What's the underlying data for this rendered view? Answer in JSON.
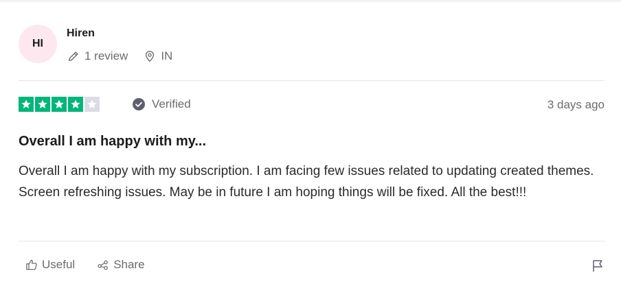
{
  "reviewer": {
    "initials": "HI",
    "name": "Hiren",
    "review_count": "1 review",
    "country": "IN",
    "avatar_color": "#fde8ef"
  },
  "rating": {
    "stars": 4,
    "max": 5,
    "filled_color": "#00b67a",
    "empty_color": "#dcdce6"
  },
  "verified_label": "Verified",
  "date": "3 days ago",
  "review": {
    "title": "Overall I am happy with my...",
    "body": "Overall I am happy with my subscription. I am facing few issues related to updating created themes. Screen refreshing issues. May be in future I am hoping things will be fixed. All the best!!!"
  },
  "actions": {
    "useful_label": "Useful",
    "share_label": "Share"
  },
  "icons": [
    "pencil-icon",
    "location-pin-icon",
    "star-icon",
    "verified-check-icon",
    "thumbs-up-icon",
    "share-icon",
    "flag-icon"
  ]
}
